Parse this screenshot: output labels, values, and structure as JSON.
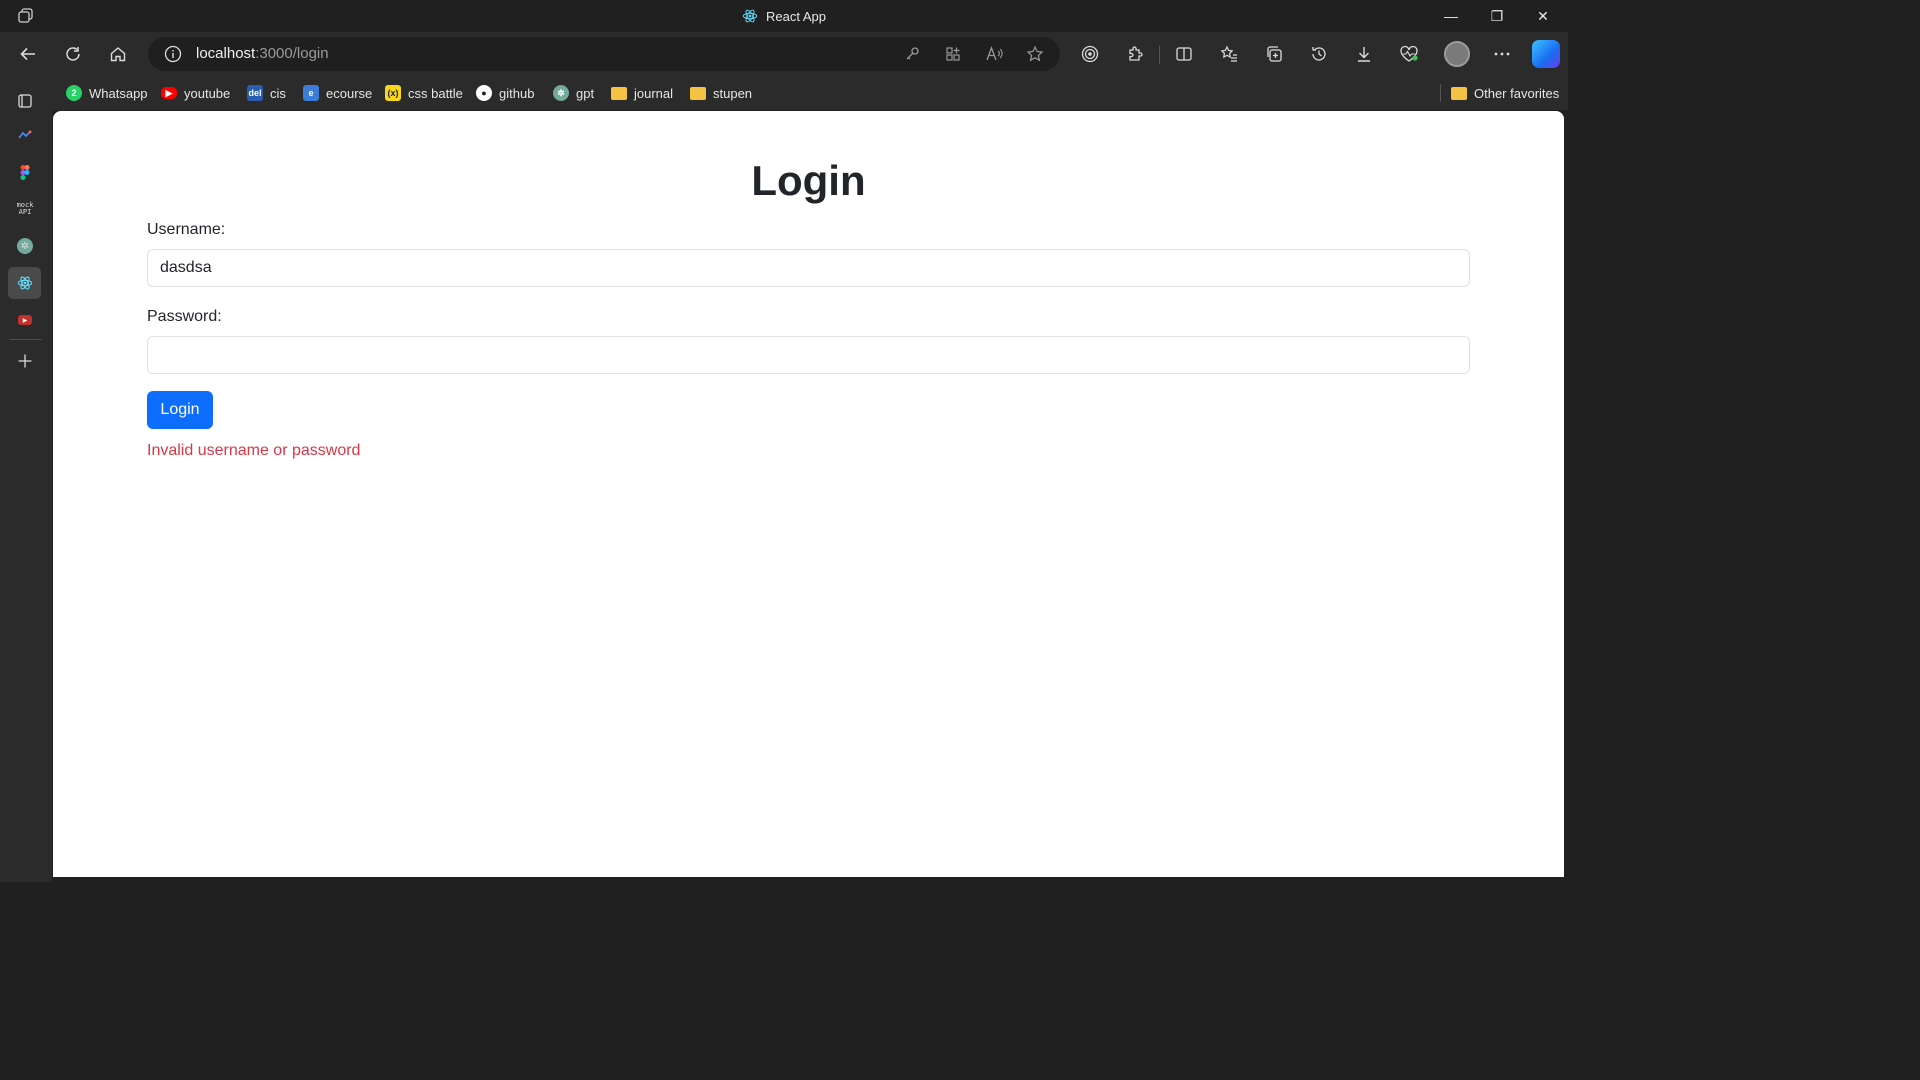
{
  "window": {
    "title": "React App",
    "minimize_glyph": "—",
    "restore_glyph": "❐",
    "close_glyph": "✕"
  },
  "toolbar": {
    "url_host": "localhost",
    "url_path": ":3000/login",
    "icons": [
      "back-icon",
      "refresh-icon",
      "home-icon",
      "info-icon",
      "key-icon",
      "apps-icon",
      "read-aloud-icon",
      "favorite-star-icon",
      "tracking-icon",
      "extensions-icon",
      "split-screen-icon",
      "favorites-icon",
      "collections-icon",
      "history-icon",
      "downloads-icon",
      "performance-icon",
      "profile-avatar",
      "more-icon",
      "copilot-icon"
    ]
  },
  "bookmarks": {
    "items": [
      {
        "label": "Whatsapp",
        "icon": "whatsapp-icon",
        "color": "#25d366"
      },
      {
        "label": "youtube",
        "icon": "youtube-icon",
        "color": "#ff0000"
      },
      {
        "label": "cis",
        "icon": "cis-icon",
        "color": "#2a5db0"
      },
      {
        "label": "ecourse",
        "icon": "ecourse-icon",
        "color": "#3b7dd8"
      },
      {
        "label": "css battle",
        "icon": "css-battle-icon",
        "color": "#f9d71c"
      },
      {
        "label": "github",
        "icon": "github-icon",
        "color": "#ffffff"
      },
      {
        "label": "gpt",
        "icon": "gpt-icon",
        "color": "#74aa9c"
      },
      {
        "label": "journal",
        "icon": "folder-icon",
        "color": "#f5c343"
      },
      {
        "label": "stupen",
        "icon": "folder-icon",
        "color": "#f5c343"
      }
    ],
    "other": "Other favorites"
  },
  "sidebar": {
    "items": [
      {
        "name": "tab-actions-icon"
      },
      {
        "name": "sidebar-app-icon"
      },
      {
        "name": "figma-icon"
      },
      {
        "name": "mockapi-icon",
        "text": "mock\nAPI"
      },
      {
        "name": "chatgpt-icon"
      },
      {
        "name": "react-app-icon"
      },
      {
        "name": "youtube-icon"
      },
      {
        "name": "add-icon"
      }
    ]
  },
  "page": {
    "title": "Login",
    "username_label": "Username:",
    "username_value": "dasdsa",
    "password_label": "Password:",
    "password_value": "",
    "login_button": "Login",
    "error": "Invalid username or password",
    "colors": {
      "button": "#0d6efd",
      "error": "#dc3545",
      "text": "#212529"
    }
  }
}
